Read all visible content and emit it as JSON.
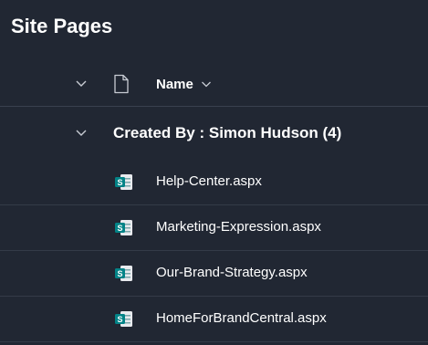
{
  "page": {
    "title": "Site Pages"
  },
  "header": {
    "name_column_label": "Name",
    "icons": [
      "chevron-down-icon",
      "document-icon",
      "sort-chevron-icon"
    ]
  },
  "group": {
    "label": "Created By : Simon Hudson (4)"
  },
  "files": [
    {
      "name": "Help-Center.aspx",
      "icon": "sharepoint-page-icon"
    },
    {
      "name": "Marketing-Expression.aspx",
      "icon": "sharepoint-page-icon"
    },
    {
      "name": "Our-Brand-Strategy.aspx",
      "icon": "sharepoint-page-icon"
    },
    {
      "name": "HomeForBrandCentral.aspx",
      "icon": "sharepoint-page-icon"
    }
  ],
  "colors": {
    "background": "#212733",
    "text": "#ffffff",
    "sharepoint_teal": "#038387",
    "divider": "#343b48"
  }
}
